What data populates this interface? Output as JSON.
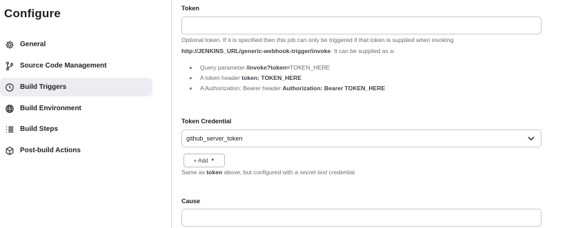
{
  "sidebar": {
    "title": "Configure",
    "items": [
      {
        "label": "General",
        "icon": "gear-icon"
      },
      {
        "label": "Source Code Management",
        "icon": "branch-icon"
      },
      {
        "label": "Build Triggers",
        "icon": "clock-icon",
        "active": true
      },
      {
        "label": "Build Environment",
        "icon": "globe-icon"
      },
      {
        "label": "Build Steps",
        "icon": "list-icon"
      },
      {
        "label": "Post-build Actions",
        "icon": "cube-icon"
      }
    ]
  },
  "token": {
    "label": "Token",
    "value": "",
    "help_line1": "Optional token. If it is specified then this job can only be triggered if that token is supplied when invoking",
    "help_url": "http://JENKINS_URL/generic-webhook-trigger/invoke",
    "help_line2_tail": ". It can be supplied as a:",
    "bullets": [
      {
        "prefix": "Query parameter ",
        "bold": "/invoke?token=",
        "suffix": "TOKEN_HERE"
      },
      {
        "prefix": "A token header ",
        "bold": "token: TOKEN_HERE",
        "suffix": ""
      },
      {
        "prefix": "A Authorization: Bearer header ",
        "bold": "Authorization: Bearer TOKEN_HERE",
        "suffix": ""
      }
    ]
  },
  "token_credential": {
    "label": "Token Credential",
    "selected": "github_server_token",
    "add_label": "+ Add",
    "help_prefix": "Same as ",
    "help_bold": "token",
    "help_mid": " above, but configured with a ",
    "help_italic": "secret text",
    "help_suffix": " credential."
  },
  "cause": {
    "label": "Cause",
    "value": ""
  }
}
